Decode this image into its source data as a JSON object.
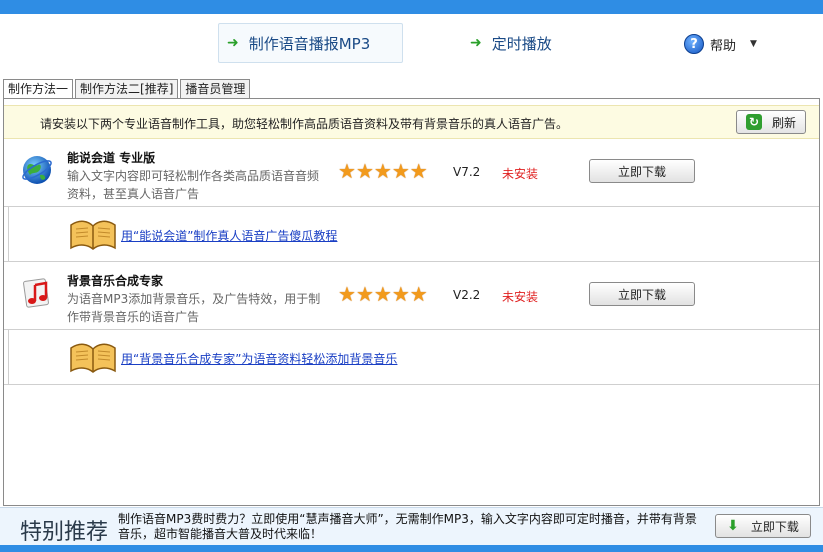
{
  "toolbar": {
    "make_mp3_label": "制作语音播报MP3",
    "timed_play_label": "定时播放",
    "help_label": "帮助"
  },
  "tabs": [
    {
      "label": "制作方法一"
    },
    {
      "label": "制作方法二[推荐]"
    },
    {
      "label": "播音员管理"
    }
  ],
  "notice": {
    "text": "请安装以下两个专业语音制作工具，助您轻松制作高品质语音资料及带有背景音乐的真人语音广告。",
    "refresh_label": "刷新"
  },
  "products": [
    {
      "name": "能说会道 专业版",
      "description": "输入文字内容即可轻松制作各类高品质语音音频资料，甚至真人语音广告",
      "rating": 5,
      "version": "V7.2",
      "status": "未安装",
      "download_label": "立即下载",
      "tutorial": "用“能说会道”制作真人语音广告傻瓜教程",
      "icon": "globe-icon"
    },
    {
      "name": "背景音乐合成专家",
      "description": "为语音MP3添加背景音乐，及广告特效，用于制作带背景音乐的语音广告",
      "rating": 5,
      "version": "V2.2",
      "status": "未安装",
      "download_label": "立即下载",
      "tutorial": "用“背景音乐合成专家”为语音资料轻松添加背景音乐",
      "icon": "music-note-icon"
    }
  ],
  "footer": {
    "title": "特别推荐",
    "text": "制作语音MP3费时费力？立即使用“慧声播音大师”，无需制作MP3，输入文字内容即可定时播音，并带有背景音乐，超市智能播音大普及时代来临！",
    "download_label": "立即下载"
  },
  "colors": {
    "accent_blue": "#2f8de4",
    "status_red": "#e02020",
    "star_orange": "#f29a1c",
    "link_blue": "#1a3fc4"
  }
}
